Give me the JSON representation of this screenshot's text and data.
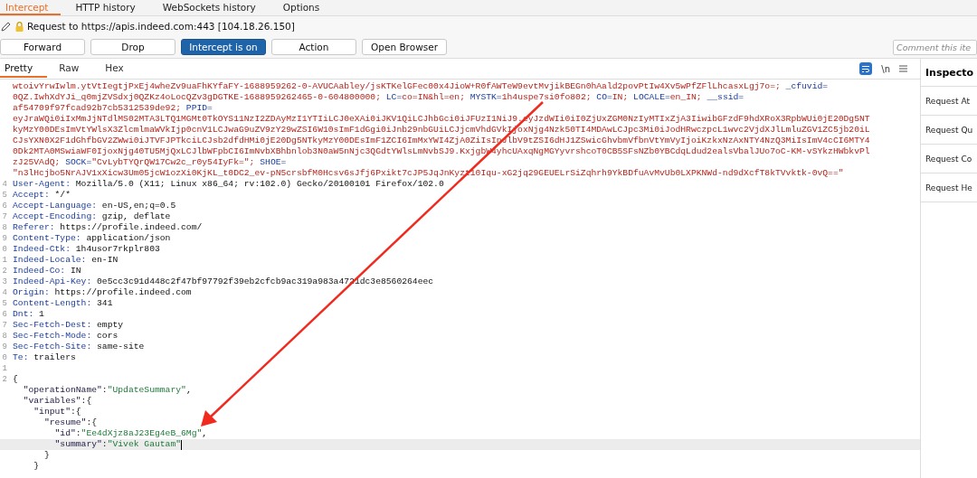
{
  "main_tabs": [
    {
      "label": "Intercept",
      "selected": true
    },
    {
      "label": "HTTP history",
      "selected": false
    },
    {
      "label": "WebSockets history",
      "selected": false
    },
    {
      "label": "Options",
      "selected": false
    }
  ],
  "request_info": "Request to https://apis.indeed.com:443  [104.18.26.150]",
  "buttons": [
    {
      "label": "Forward",
      "on": false
    },
    {
      "label": "Drop",
      "on": false
    },
    {
      "label": "Intercept is on",
      "on": true
    },
    {
      "label": "Action",
      "on": false
    },
    {
      "label": "Open Browser",
      "on": false
    }
  ],
  "comment": {
    "placeholder": "Comment this ite"
  },
  "editor": {
    "tabs": [
      {
        "label": "Pretty",
        "selected": true
      },
      {
        "label": "Raw",
        "selected": false
      },
      {
        "label": "Hex",
        "selected": false
      }
    ],
    "wrap_on": true,
    "newline_toggle": "\\n",
    "lines": [
      {
        "segments": [
          {
            "kind": "value",
            "text": "wtoivYrwIwlm.ytVtIegtjPxEj4wheZv9uaFhKYfaFY-1688959262-0-AVUCAabley/jsKTKelGFec00x4JioW+R0fAWTeW9evtMvjikBEGn0hAald2povPtIw4Xv5wPfZFlLhcasxLgj7o=; "
          },
          {
            "kind": "name",
            "text": "_cfuvid="
          }
        ]
      },
      {
        "segments": [
          {
            "kind": "value",
            "text": "0QZ.IwhXdYJi_q0mjZVSdxj0QZKz4oLocQZv3gDGTKE-1688959262465-0-604800000; "
          },
          {
            "kind": "name",
            "text": "LC="
          },
          {
            "kind": "value",
            "text": "co=IN&hl=en; "
          },
          {
            "kind": "name",
            "text": "MYSTK="
          },
          {
            "kind": "value",
            "text": "1h4uspe7si0fo802; "
          },
          {
            "kind": "name",
            "text": "CO="
          },
          {
            "kind": "value",
            "text": "IN; "
          },
          {
            "kind": "name",
            "text": "LOCALE="
          },
          {
            "kind": "value",
            "text": "en_IN; "
          },
          {
            "kind": "name",
            "text": "__ssid="
          }
        ]
      },
      {
        "segments": [
          {
            "kind": "value",
            "text": "af54709f97fcad92b7cb5312539de92; "
          },
          {
            "kind": "name",
            "text": "PPID="
          }
        ]
      },
      {
        "segments": [
          {
            "kind": "value",
            "text": "eyJraWQi0iIxMmJjNTdlMS02MTA3LTQ1MGMt0TkOYS11NzI2ZDAyMzI1YTIiLCJ0eXAi0iJKV1QiLCJhbGci0iJFUzI1NiJ9.eyJzdWIi0iI0ZjUxZGM0NzIyMTIxZjA3IiwibGFzdF9hdXRoX3RpbWUi0jE20Dg5NT"
          }
        ]
      },
      {
        "segments": [
          {
            "kind": "value",
            "text": "kyMzY00DEsImVtYWlsX3ZlcmlmaWVkIjp0cnV1LCJwaG9uZV9zY29wZSI6W10sImF1dGgi0iJnb29nbGUiLCJjcmVhdGVkIjoxNjg4Nzk50TI4MDAwLCJpc3Mi0iJodHRwczpcL1wvc2VjdXJlLmluZGV1ZC5jb20iL"
          }
        ]
      },
      {
        "segments": [
          {
            "kind": "value",
            "text": "CJsYXN0X2F1dGhfbGV2ZWwi0iJTVFJPTkciLCJsb2dfdHMi0jE20Dg5NTkyMzY00DEsImF1ZCI6ImMxYWI4ZjA0ZiIsInJlbV9tZSI6dHJ1ZSwicGhvbmVfbnVtYmVyIjoiKzkxNzAxNTY4NzQ3MiIsImV4cCI6MTY4"
          }
        ]
      },
      {
        "segments": [
          {
            "kind": "value",
            "text": "0Dk2MTA0MSwiaWF0IjoxNjg40TU5MjQxLCJlbWFpbCI6ImNvbXBhbnlob3N0aW5nNjc3QGdtYWlsLmNvbSJ9.KxjgbW4yhcUAxqNgMGYyvrshcoT0CB5SFsNZb0YBCdqLdud2ealsVbalJUo7oC-KM-vSYkzHWbkvPl"
          }
        ]
      },
      {
        "segments": [
          {
            "kind": "value",
            "text": "zJ25VAdQ; "
          },
          {
            "kind": "name",
            "text": "SOCK="
          },
          {
            "kind": "value",
            "text": "\"CvLybTYQrQW17Cw2c_r0y54IyFk=\"; "
          },
          {
            "kind": "name",
            "text": "SHOE="
          }
        ]
      },
      {
        "segments": [
          {
            "kind": "value",
            "text": "\"n3lHcjbo5NrAJV1xXicw3Um05jcW1ozXi0KjKL_t0DC2_ev-pN5crsbfM0Hcsv6sJfj6Pxikt7cJP5JqJnKyzt10Iqu-xG2jq29GEUELrSiZqhrh9YkBDfuAvMvUb0LXPKNWd-nd9dXcfT8kTVvktk-0vQ==\""
          }
        ]
      },
      {
        "number": "4",
        "segments": [
          {
            "kind": "name",
            "text": "User-Agent:"
          },
          {
            "kind": "plain",
            "text": " Mozilla/5.0 (X11; Linux x86_64; rv:102.0) Gecko/20100101 Firefox/102.0"
          }
        ]
      },
      {
        "number": "5",
        "segments": [
          {
            "kind": "name",
            "text": "Accept:"
          },
          {
            "kind": "plain",
            "text": " */*"
          }
        ]
      },
      {
        "number": "6",
        "segments": [
          {
            "kind": "name",
            "text": "Accept-Language:"
          },
          {
            "kind": "plain",
            "text": " en-US,en;q=0.5"
          }
        ]
      },
      {
        "number": "7",
        "segments": [
          {
            "kind": "name",
            "text": "Accept-Encoding:"
          },
          {
            "kind": "plain",
            "text": " gzip, deflate"
          }
        ]
      },
      {
        "number": "8",
        "segments": [
          {
            "kind": "name",
            "text": "Referer:"
          },
          {
            "kind": "plain",
            "text": " https://profile.indeed.com/"
          }
        ]
      },
      {
        "number": "9",
        "segments": [
          {
            "kind": "name",
            "text": "Content-Type:"
          },
          {
            "kind": "plain",
            "text": " application/json"
          }
        ]
      },
      {
        "number": "0",
        "segments": [
          {
            "kind": "name",
            "text": "Indeed-Ctk:"
          },
          {
            "kind": "plain",
            "text": " 1h4usor7rkplr803"
          }
        ]
      },
      {
        "number": "1",
        "segments": [
          {
            "kind": "name",
            "text": "Indeed-Locale:"
          },
          {
            "kind": "plain",
            "text": " en-IN"
          }
        ]
      },
      {
        "number": "2",
        "segments": [
          {
            "kind": "name",
            "text": "Indeed-Co:"
          },
          {
            "kind": "plain",
            "text": " IN"
          }
        ]
      },
      {
        "number": "3",
        "segments": [
          {
            "kind": "name",
            "text": "Indeed-Api-Key:"
          },
          {
            "kind": "plain",
            "text": " 0e5cc3c91d448c2f47bf97792f39eb2cfcb9ac319a983a4721dc3e8560264eec"
          }
        ]
      },
      {
        "number": "4",
        "segments": [
          {
            "kind": "name",
            "text": "Origin:"
          },
          {
            "kind": "plain",
            "text": " https://profile.indeed.com"
          }
        ]
      },
      {
        "number": "5",
        "segments": [
          {
            "kind": "name",
            "text": "Content-Length:"
          },
          {
            "kind": "plain",
            "text": " 341"
          }
        ]
      },
      {
        "number": "6",
        "segments": [
          {
            "kind": "name",
            "text": "Dnt:"
          },
          {
            "kind": "plain",
            "text": " 1"
          }
        ]
      },
      {
        "number": "7",
        "segments": [
          {
            "kind": "name",
            "text": "Sec-Fetch-Dest:"
          },
          {
            "kind": "plain",
            "text": " empty"
          }
        ]
      },
      {
        "number": "8",
        "segments": [
          {
            "kind": "name",
            "text": "Sec-Fetch-Mode:"
          },
          {
            "kind": "plain",
            "text": " cors"
          }
        ]
      },
      {
        "number": "9",
        "segments": [
          {
            "kind": "name",
            "text": "Sec-Fetch-Site:"
          },
          {
            "kind": "plain",
            "text": " same-site"
          }
        ]
      },
      {
        "number": "0",
        "segments": [
          {
            "kind": "name",
            "text": "Te:"
          },
          {
            "kind": "plain",
            "text": " trailers"
          }
        ]
      },
      {
        "number": "1"
      },
      {
        "number": "2",
        "segments": [
          {
            "kind": "plain",
            "text": "{"
          }
        ]
      },
      {
        "segments": [
          {
            "kind": "json_key",
            "text": "  \"operationName\""
          },
          {
            "kind": "plain",
            "text": ":"
          },
          {
            "kind": "json_string",
            "text": "\"UpdateSummary\""
          },
          {
            "kind": "plain",
            "text": ","
          }
        ]
      },
      {
        "segments": [
          {
            "kind": "json_key",
            "text": "  \"variables\""
          },
          {
            "kind": "plain",
            "text": ":{"
          }
        ]
      },
      {
        "segments": [
          {
            "kind": "json_key",
            "text": "    \"input\""
          },
          {
            "kind": "plain",
            "text": ":{"
          }
        ]
      },
      {
        "segments": [
          {
            "kind": "json_key",
            "text": "      \"resume\""
          },
          {
            "kind": "plain",
            "text": ":{"
          }
        ]
      },
      {
        "segments": [
          {
            "kind": "json_key",
            "text": "        \"id\""
          },
          {
            "kind": "plain",
            "text": ":"
          },
          {
            "kind": "json_string",
            "text": "\"Ee4dXjz8aJ23Eg4eB_6Mg\""
          },
          {
            "kind": "plain",
            "text": ","
          }
        ]
      },
      {
        "current": true,
        "segments": [
          {
            "kind": "json_key",
            "text": "        \"summary\""
          },
          {
            "kind": "plain",
            "text": ":"
          },
          {
            "kind": "json_string",
            "text": "\"Vivek Gautam\""
          }
        ]
      },
      {
        "segments": [
          {
            "kind": "plain",
            "text": "      }"
          }
        ]
      },
      {
        "segments": [
          {
            "kind": "plain",
            "text": "    }"
          }
        ]
      }
    ]
  },
  "inspector": {
    "title": "Inspecto",
    "sections": [
      "Request At",
      "Request Qu",
      "Request Co",
      "Request He"
    ]
  }
}
